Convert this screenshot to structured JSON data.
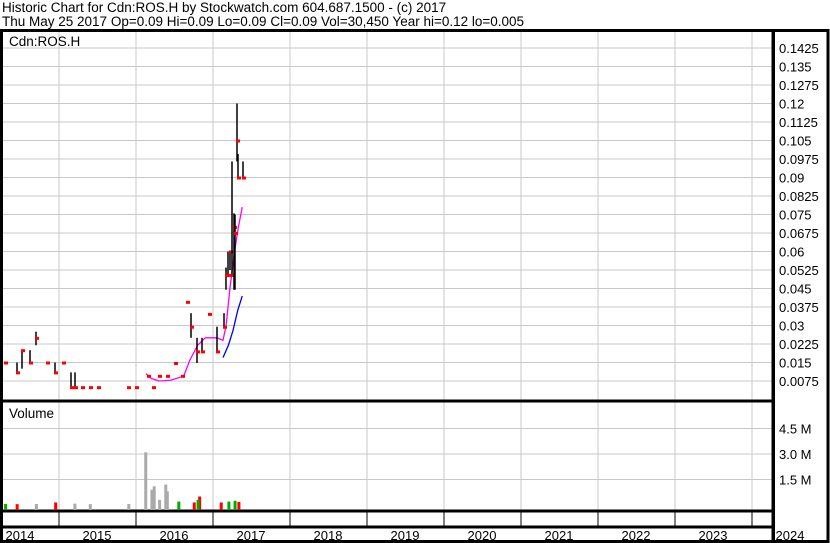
{
  "header": {
    "title": "Historic Chart for Cdn:ROS.H by Stockwatch.com 604.687.1500 - (c) 2017",
    "quote": "Thu May 25 2017  Op=0.09  Hi=0.09  Lo=0.09  Cl=0.09  Vol=30,450  Year hi=0.12  lo=0.005"
  },
  "chart_data": {
    "type": "ohlc",
    "symbol_label": "Cdn:ROS.H",
    "volume_label": "Volume",
    "price_ticks": [
      "0.1425",
      "0.135",
      "0.1275",
      "0.12",
      "0.1125",
      "0.105",
      "0.0975",
      "0.09",
      "0.0825",
      "0.075",
      "0.0675",
      "0.06",
      "0.0525",
      "0.045",
      "0.0375",
      "0.03",
      "0.0225",
      "0.015",
      "0.0075"
    ],
    "price_range": [
      0.0075,
      0.1425
    ],
    "volume_ticks": [
      {
        "label": "4.5 M",
        "value": 4500000
      },
      {
        "label": "3.0 M",
        "value": 3000000
      },
      {
        "label": "1.5 M",
        "value": 1500000
      }
    ],
    "x_years": [
      "2014",
      "2015",
      "2016",
      "2017",
      "2018",
      "2019",
      "2020",
      "2021",
      "2022",
      "2023",
      "2024"
    ],
    "bars": [
      [
        2014.3,
        0.015,
        0.015,
        0.015
      ],
      [
        2014.45,
        0.015,
        0.011,
        0.011
      ],
      [
        2014.52,
        0.02,
        0.0125,
        0.02
      ],
      [
        2014.62,
        0.02,
        0.015,
        0.015
      ],
      [
        2014.7,
        0.0275,
        0.022,
        0.025
      ],
      [
        2014.85,
        0.015,
        0.015,
        0.015
      ],
      [
        2014.95,
        0.015,
        0.011,
        0.011
      ],
      [
        2015.05,
        0.015,
        0.015,
        0.015
      ],
      [
        2015.15,
        0.011,
        0.005,
        0.005
      ],
      [
        2015.21,
        0.011,
        0.005,
        0.005
      ],
      [
        2015.3,
        0.005,
        0.005,
        0.005
      ],
      [
        2015.4,
        0.005,
        0.005,
        0.005
      ],
      [
        2015.5,
        0.005,
        0.005,
        0.005
      ],
      [
        2015.9,
        0.005,
        0.005,
        0.005
      ],
      [
        2016.0,
        0.005,
        0.005,
        0.005
      ],
      [
        2016.15,
        0.0096,
        0.0096,
        0.0096
      ],
      [
        2016.22,
        0.005,
        0.005,
        0.005
      ],
      [
        2016.3,
        0.0096,
        0.0096,
        0.0096
      ],
      [
        2016.4,
        0.0096,
        0.0096,
        0.0096
      ],
      [
        2016.5,
        0.0148,
        0.0148,
        0.0148
      ],
      [
        2016.6,
        0.0096,
        0.0096,
        0.0096
      ],
      [
        2016.66,
        0.0396,
        0.0396,
        0.0396
      ],
      [
        2016.71,
        0.035,
        0.025,
        0.0295
      ],
      [
        2016.79,
        0.025,
        0.0148,
        0.0195
      ],
      [
        2016.86,
        0.025,
        0.0195,
        0.0195
      ],
      [
        2016.95,
        0.0347,
        0.0347,
        0.0347
      ],
      [
        2017.05,
        0.0295,
        0.0195,
        0.0195
      ],
      [
        2017.14,
        0.035,
        0.0295,
        0.0295
      ],
      [
        2017.17,
        0.0535,
        0.0445,
        0.0505
      ],
      [
        2017.19,
        0.06,
        0.0505,
        0.0505
      ],
      [
        2017.22,
        0.06,
        0.0525,
        0.06
      ],
      [
        2017.25,
        0.0965,
        0.0505,
        0.0505
      ],
      [
        2017.27,
        0.0755,
        0.0445,
        0.07
      ],
      [
        2017.29,
        0.075,
        0.0445,
        0.0675
      ],
      [
        2017.31,
        0.12,
        0.0965,
        0.105
      ],
      [
        2017.33,
        0.0995,
        0.0895,
        0.09
      ],
      [
        2017.39,
        0.0965,
        0.0895,
        0.09
      ]
    ],
    "ma_short": [
      [
        2016.13,
        0.0105
      ],
      [
        2016.2,
        0.0085
      ],
      [
        2016.3,
        0.0075
      ],
      [
        2016.45,
        0.0078
      ],
      [
        2016.62,
        0.0095
      ],
      [
        2016.7,
        0.016
      ],
      [
        2016.8,
        0.022
      ],
      [
        2016.9,
        0.025
      ],
      [
        2017.05,
        0.025
      ],
      [
        2017.13,
        0.024
      ],
      [
        2017.17,
        0.03
      ],
      [
        2017.22,
        0.045
      ],
      [
        2017.28,
        0.06
      ],
      [
        2017.33,
        0.07
      ],
      [
        2017.38,
        0.078
      ]
    ],
    "ma_long": [
      [
        2017.13,
        0.017
      ],
      [
        2017.2,
        0.022
      ],
      [
        2017.26,
        0.028
      ],
      [
        2017.32,
        0.036
      ],
      [
        2017.38,
        0.042
      ]
    ],
    "volume": [
      [
        2014.3,
        60000,
        "#00aa00"
      ],
      [
        2014.45,
        50000,
        "#ff0000"
      ],
      [
        2014.7,
        60000,
        "#aaaaaa"
      ],
      [
        2014.95,
        150000,
        "#ff0000"
      ],
      [
        2015.2,
        80000,
        "#aaaaaa"
      ],
      [
        2015.4,
        50000,
        "#aaaaaa"
      ],
      [
        2015.9,
        60000,
        "#aaaaaa"
      ],
      [
        2016.12,
        3100000,
        "#aaaaaa"
      ],
      [
        2016.2,
        900000,
        "#aaaaaa"
      ],
      [
        2016.23,
        1100000,
        "#aaaaaa"
      ],
      [
        2016.3,
        300000,
        "#aaaaaa"
      ],
      [
        2016.38,
        1200000,
        "#aaaaaa"
      ],
      [
        2016.4,
        800000,
        "#aaaaaa"
      ],
      [
        2016.55,
        200000,
        "#00aa00"
      ],
      [
        2016.75,
        150000,
        "#ff0000"
      ],
      [
        2016.82,
        500000,
        "#ff0000"
      ],
      [
        2016.8,
        300000,
        "#00aa00"
      ],
      [
        2017.1,
        150000,
        "#ff0000"
      ],
      [
        2017.2,
        200000,
        "#00aa00"
      ],
      [
        2017.28,
        250000,
        "#00aa00"
      ],
      [
        2017.33,
        180000,
        "#ff0000"
      ]
    ],
    "colors": {
      "bar": "#000000",
      "close": "#ff0000",
      "ma_short": "#ff00ff",
      "ma_long": "#0000ff",
      "grid": "#c8c8c8"
    }
  }
}
